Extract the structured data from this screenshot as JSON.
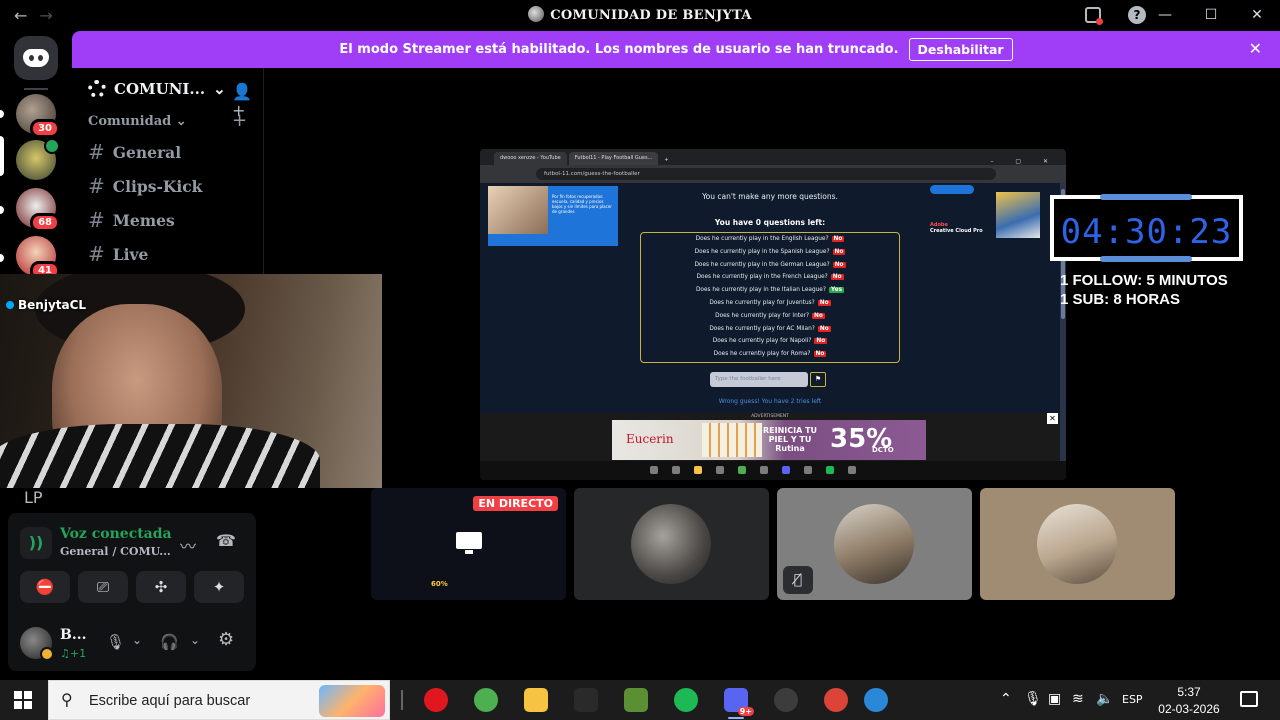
{
  "window": {
    "title": "COMUNIDAD DE BENJYTA",
    "back": "←",
    "forward": "→",
    "minimize": "—",
    "maximize": "☐",
    "close": "✕"
  },
  "banner": {
    "text": "El modo Streamer está habilitado. Los nombres de usuario se han truncado.",
    "button": "Deshabilitar",
    "close": "✕"
  },
  "rail": {
    "servers": [
      {
        "badge": "30"
      },
      {
        "badge": ""
      },
      {
        "badge": "68"
      },
      {
        "badge": "41"
      }
    ]
  },
  "sidebar": {
    "server_name": "COMUNI...",
    "chevron": "⌄",
    "add_member_icon": "👤+",
    "category": "Comunidad ⌄",
    "category_add": "+",
    "channels": [
      {
        "hash": "#",
        "name": "General"
      },
      {
        "hash": "#",
        "name": "Clips-Kick"
      },
      {
        "hash": "#",
        "name": "Memes"
      },
      {
        "hash": "#",
        "name": "Live"
      }
    ]
  },
  "webcam": {
    "name": "BenjytaCL"
  },
  "lp_text": "LP",
  "voice": {
    "signal_icon": "))",
    "status": "Voz conectada",
    "channel": "General / COMU...",
    "noise_icon": "〰",
    "disconnect_icon": "☎",
    "buttons": [
      "⛔",
      "⎚",
      "✣",
      "✦"
    ],
    "user": {
      "name": "B...",
      "status": "♫+1",
      "mic_icon": "🎙",
      "mic_chevron": "⌄",
      "headset_icon": "🎧",
      "headset_chevron": "⌄",
      "settings_icon": "⚙"
    }
  },
  "stream": {
    "tabs": [
      "dwooo xenzze - YouTube",
      "Futbol11 - Play Football Gues..."
    ],
    "tab_plus": "+",
    "window_controls": "– ▢ ✕",
    "url": "futbol-11.com/guess-the-footballer",
    "left_promo": "Por fin fotos recuperadas: escuela, calidad y precios bajos y sin límites para placer de grandes",
    "msg_no_more": "You can't make any more questions.",
    "msg_left": "You have 0 questions left:",
    "questions": [
      {
        "q": "Does he currently play in the English League?",
        "a": "No"
      },
      {
        "q": "Does he currently play in the Spanish League?",
        "a": "No"
      },
      {
        "q": "Does he currently play in the German League?",
        "a": "No"
      },
      {
        "q": "Does he currently play in the French League?",
        "a": "No"
      },
      {
        "q": "Does he currently play in the Italian League?",
        "a": "Yes"
      },
      {
        "q": "Does he currently play for Juventus?",
        "a": "No"
      },
      {
        "q": "Does he currently play for Inter?",
        "a": "No"
      },
      {
        "q": "Does he currently play for AC Milan?",
        "a": "No"
      },
      {
        "q": "Does he currently play for Napoli?",
        "a": "No"
      },
      {
        "q": "Does he currently play for Roma?",
        "a": "No"
      }
    ],
    "guess_placeholder": "Type the footballer here",
    "flag_icon": "⚑",
    "wrong": "Wrong guess! You have 2 tries left",
    "adobe_brand": "Adobe",
    "adobe_product": "Creative Cloud Pro",
    "ad_label": "ADVERTISEMENT",
    "ad_brand": "Eucerin",
    "ad_mid": "REINICIA TU PIEL Y TU Rutina",
    "ad_pct": "35%",
    "ad_dcto": "DCTO",
    "ad_close": "✕"
  },
  "overlay": {
    "timer": "04:30:23",
    "follow": "1 FOLLOW: 5 MINUTOS",
    "sub": "1 SUB: 8 HORAS"
  },
  "tiles": {
    "live_label": "EN DIRECTO",
    "progress": "60%",
    "mute_icon": "🎙̸"
  },
  "taskbar": {
    "search_placeholder": "Escribe aquí para buscar",
    "search_icon": "⚲",
    "apps": [
      {
        "icon": "opera-icon",
        "color": "#e0171f"
      },
      {
        "icon": "chrome-icon",
        "color": "#4caf50"
      },
      {
        "icon": "file-explorer-icon",
        "color": "#f6c343"
      },
      {
        "icon": "epic-games-icon",
        "color": "#2a2a2a"
      },
      {
        "icon": "minecraft-icon",
        "color": "#5b8f34"
      },
      {
        "icon": "spotify-icon",
        "color": "#1db954"
      },
      {
        "icon": "discord-icon",
        "color": "#5865f2"
      },
      {
        "icon": "obs-icon",
        "color": "#3c3c3c"
      },
      {
        "icon": "chrome-profile-icon",
        "color": "#db4437"
      },
      {
        "icon": "help-icon",
        "color": "#2b88d8"
      }
    ],
    "discord_badge": "9+",
    "lang": "ESP",
    "time": "5:37",
    "date": "02-03-2026"
  }
}
